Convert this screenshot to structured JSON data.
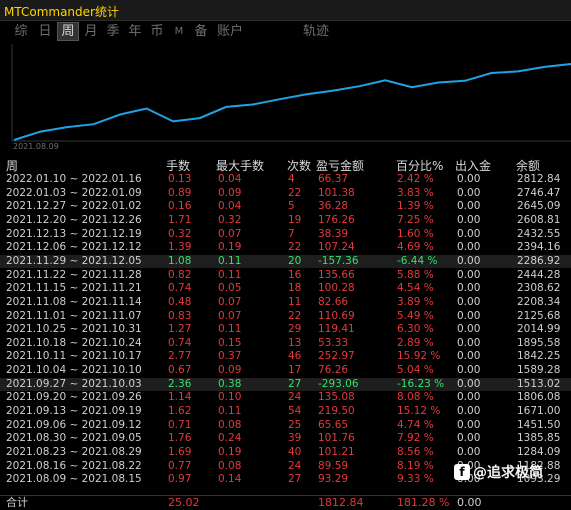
{
  "window": {
    "title": "MTCommander统计"
  },
  "tabs": [
    {
      "label": "综"
    },
    {
      "label": "日"
    },
    {
      "label": "周"
    },
    {
      "label": "月"
    },
    {
      "label": "季"
    },
    {
      "label": "年"
    },
    {
      "label": "币"
    },
    {
      "label": "M"
    },
    {
      "label": "备"
    },
    {
      "label": "账户"
    },
    {
      "label": "轨迹"
    }
  ],
  "chart": {
    "start_label": "2021.08.09",
    "line_color": "#1fa3e6",
    "values": [
      1093.29,
      1284.09,
      1385.85,
      1451.5,
      1671.0,
      1806.08,
      1513.02,
      1589.28,
      1842.25,
      1895.58,
      2014.99,
      2125.68,
      2208.34,
      2308.62,
      2444.28,
      2286.92,
      2394.16,
      2432.55,
      2608.81,
      2645.09,
      2746.47,
      2812.84
    ]
  },
  "table": {
    "headers": {
      "period": "周",
      "lots": "手数",
      "max_lots": "最大手数",
      "count": "次数",
      "pnl": "盈亏金额",
      "pct": "百分比%",
      "io": "出入金",
      "balance": "余额"
    },
    "rows": [
      {
        "period": "2022.01.10 ~ 2022.01.16",
        "lots": "0.13",
        "max_lots": "0.04",
        "count": "4",
        "pnl": "66.37",
        "pct": "2.42 %",
        "io": "0.00",
        "balance": "2812.84",
        "sign": "neg"
      },
      {
        "period": "2022.01.03 ~ 2022.01.09",
        "lots": "0.89",
        "max_lots": "0.09",
        "count": "22",
        "pnl": "101.38",
        "pct": "3.83 %",
        "io": "0.00",
        "balance": "2746.47",
        "sign": "neg"
      },
      {
        "period": "2021.12.27 ~ 2022.01.02",
        "lots": "0.16",
        "max_lots": "0.04",
        "count": "5",
        "pnl": "36.28",
        "pct": "1.39 %",
        "io": "0.00",
        "balance": "2645.09",
        "sign": "neg"
      },
      {
        "period": "2021.12.20 ~ 2021.12.26",
        "lots": "1.71",
        "max_lots": "0.32",
        "count": "19",
        "pnl": "176.26",
        "pct": "7.25 %",
        "io": "0.00",
        "balance": "2608.81",
        "sign": "neg"
      },
      {
        "period": "2021.12.13 ~ 2021.12.19",
        "lots": "0.32",
        "max_lots": "0.07",
        "count": "7",
        "pnl": "38.39",
        "pct": "1.60 %",
        "io": "0.00",
        "balance": "2432.55",
        "sign": "neg"
      },
      {
        "period": "2021.12.06 ~ 2021.12.12",
        "lots": "1.39",
        "max_lots": "0.19",
        "count": "22",
        "pnl": "107.24",
        "pct": "4.69 %",
        "io": "0.00",
        "balance": "2394.16",
        "sign": "neg"
      },
      {
        "period": "2021.11.29 ~ 2021.12.05",
        "lots": "1.08",
        "max_lots": "0.11",
        "count": "20",
        "pnl": "-157.36",
        "pct": "-6.44 %",
        "io": "0.00",
        "balance": "2286.92",
        "sign": "pos"
      },
      {
        "period": "2021.11.22 ~ 2021.11.28",
        "lots": "0.82",
        "max_lots": "0.11",
        "count": "16",
        "pnl": "135.66",
        "pct": "5.88 %",
        "io": "0.00",
        "balance": "2444.28",
        "sign": "neg"
      },
      {
        "period": "2021.11.15 ~ 2021.11.21",
        "lots": "0.74",
        "max_lots": "0.05",
        "count": "18",
        "pnl": "100.28",
        "pct": "4.54 %",
        "io": "0.00",
        "balance": "2308.62",
        "sign": "neg"
      },
      {
        "period": "2021.11.08 ~ 2021.11.14",
        "lots": "0.48",
        "max_lots": "0.07",
        "count": "11",
        "pnl": "82.66",
        "pct": "3.89 %",
        "io": "0.00",
        "balance": "2208.34",
        "sign": "neg"
      },
      {
        "period": "2021.11.01 ~ 2021.11.07",
        "lots": "0.83",
        "max_lots": "0.07",
        "count": "22",
        "pnl": "110.69",
        "pct": "5.49 %",
        "io": "0.00",
        "balance": "2125.68",
        "sign": "neg"
      },
      {
        "period": "2021.10.25 ~ 2021.10.31",
        "lots": "1.27",
        "max_lots": "0.11",
        "count": "29",
        "pnl": "119.41",
        "pct": "6.30 %",
        "io": "0.00",
        "balance": "2014.99",
        "sign": "neg"
      },
      {
        "period": "2021.10.18 ~ 2021.10.24",
        "lots": "0.74",
        "max_lots": "0.15",
        "count": "13",
        "pnl": "53.33",
        "pct": "2.89 %",
        "io": "0.00",
        "balance": "1895.58",
        "sign": "neg"
      },
      {
        "period": "2021.10.11 ~ 2021.10.17",
        "lots": "2.77",
        "max_lots": "0.37",
        "count": "46",
        "pnl": "252.97",
        "pct": "15.92 %",
        "io": "0.00",
        "balance": "1842.25",
        "sign": "neg"
      },
      {
        "period": "2021.10.04 ~ 2021.10.10",
        "lots": "0.67",
        "max_lots": "0.09",
        "count": "17",
        "pnl": "76.26",
        "pct": "5.04 %",
        "io": "0.00",
        "balance": "1589.28",
        "sign": "neg"
      },
      {
        "period": "2021.09.27 ~ 2021.10.03",
        "lots": "2.36",
        "max_lots": "0.38",
        "count": "27",
        "pnl": "-293.06",
        "pct": "-16.23 %",
        "io": "0.00",
        "balance": "1513.02",
        "sign": "pos"
      },
      {
        "period": "2021.09.20 ~ 2021.09.26",
        "lots": "1.14",
        "max_lots": "0.10",
        "count": "24",
        "pnl": "135.08",
        "pct": "8.08 %",
        "io": "0.00",
        "balance": "1806.08",
        "sign": "neg"
      },
      {
        "period": "2021.09.13 ~ 2021.09.19",
        "lots": "1.62",
        "max_lots": "0.11",
        "count": "54",
        "pnl": "219.50",
        "pct": "15.12 %",
        "io": "0.00",
        "balance": "1671.00",
        "sign": "neg"
      },
      {
        "period": "2021.09.06 ~ 2021.09.12",
        "lots": "0.71",
        "max_lots": "0.08",
        "count": "25",
        "pnl": "65.65",
        "pct": "4.74 %",
        "io": "0.00",
        "balance": "1451.50",
        "sign": "neg"
      },
      {
        "period": "2021.08.30 ~ 2021.09.05",
        "lots": "1.76",
        "max_lots": "0.24",
        "count": "39",
        "pnl": "101.76",
        "pct": "7.92 %",
        "io": "0.00",
        "balance": "1385.85",
        "sign": "neg"
      },
      {
        "period": "2021.08.23 ~ 2021.08.29",
        "lots": "1.69",
        "max_lots": "0.19",
        "count": "40",
        "pnl": "101.21",
        "pct": "8.56 %",
        "io": "0.00",
        "balance": "1284.09",
        "sign": "neg"
      },
      {
        "period": "2021.08.16 ~ 2021.08.22",
        "lots": "0.77",
        "max_lots": "0.08",
        "count": "24",
        "pnl": "89.59",
        "pct": "8.19 %",
        "io": "0.00",
        "balance": "1182.88",
        "sign": "neg"
      },
      {
        "period": "2021.08.09 ~ 2021.08.15",
        "lots": "0.97",
        "max_lots": "0.14",
        "count": "27",
        "pnl": "93.29",
        "pct": "9.33 %",
        "io": "0.00",
        "balance": "1093.29",
        "sign": "neg"
      }
    ],
    "total": {
      "label": "合计",
      "lots": "25.02",
      "pnl": "1812.84",
      "pct": "181.28 %",
      "io": "0.00"
    }
  },
  "watermark": {
    "logo": "f",
    "text": "@追求极简"
  },
  "colors": {
    "negative_red": "#e23a3a",
    "positive_green": "#35e06a",
    "title_yellow": "#ffd400"
  }
}
